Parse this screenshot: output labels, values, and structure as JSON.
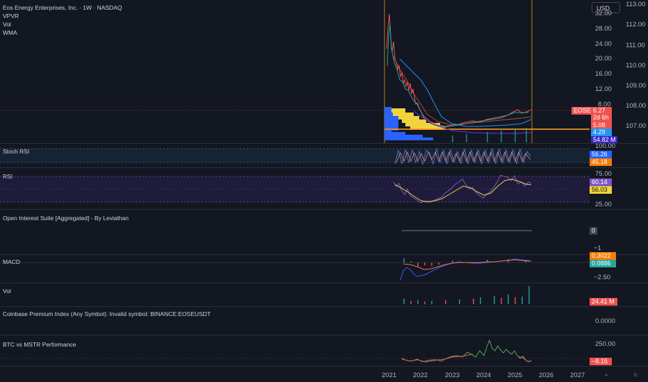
{
  "header": {
    "title": "Eos Energy Enterprises, Inc. · 1W · NASDAQ",
    "indicators": [
      "VPVR",
      "Vol",
      "WMA"
    ],
    "currency": "USD"
  },
  "price_axis_left": [
    "32.00",
    "28.00",
    "24.00",
    "20.00",
    "16.00",
    "12.00",
    "8.00"
  ],
  "price_axis_right": [
    "113.00",
    "112.00",
    "111.00",
    "110.00",
    "109.00",
    "108.00",
    "107.00"
  ],
  "price_badges": {
    "symbol": "EOSE",
    "last": "6.27",
    "countdown": "2d 6h",
    "ma1": "5.08",
    "ma2": "4.29",
    "volume": "54.82 M"
  },
  "panes": {
    "stoch_rsi": {
      "title": "Stoch RSI",
      "axis_top": "100.00",
      "k": "56.26",
      "d": "45.18"
    },
    "rsi": {
      "title": "RSI",
      "axis_top": "75.00",
      "axis_bottom": "25.00",
      "rsi": "60.14",
      "ma": "56.03"
    },
    "open_interest": {
      "title": "Open Interest Suite [Aggregated] - By Leviathan",
      "value": "0",
      "axis": "−1"
    },
    "macd": {
      "title": "MACD",
      "signal": "0.3022",
      "hist": "0.0886",
      "axis": "−2.50"
    },
    "vol": {
      "title": "Vol",
      "value": "24.41 M"
    },
    "coinbase": {
      "title": "Coinbase Premium Index (Any Symbol): Invalid symbol: BINANCE:EOSEUSDT",
      "value": "0.0000"
    },
    "btc_mstr": {
      "title": "BTC vs MSTR Performance",
      "axis_top": "250.00",
      "value": "−8.15"
    }
  },
  "time_axis": [
    "2021",
    "2022",
    "2023",
    "2024",
    "2025",
    "2026",
    "2027"
  ],
  "bottom_icons": [
    "A",
    "B"
  ],
  "colors": {
    "background": "#131722",
    "up": "#26a69a",
    "down": "#ef5350",
    "blue": "#2962ff",
    "yellow": "#f0d43a",
    "orange": "#f7931a",
    "purple": "#7e57c2"
  }
}
